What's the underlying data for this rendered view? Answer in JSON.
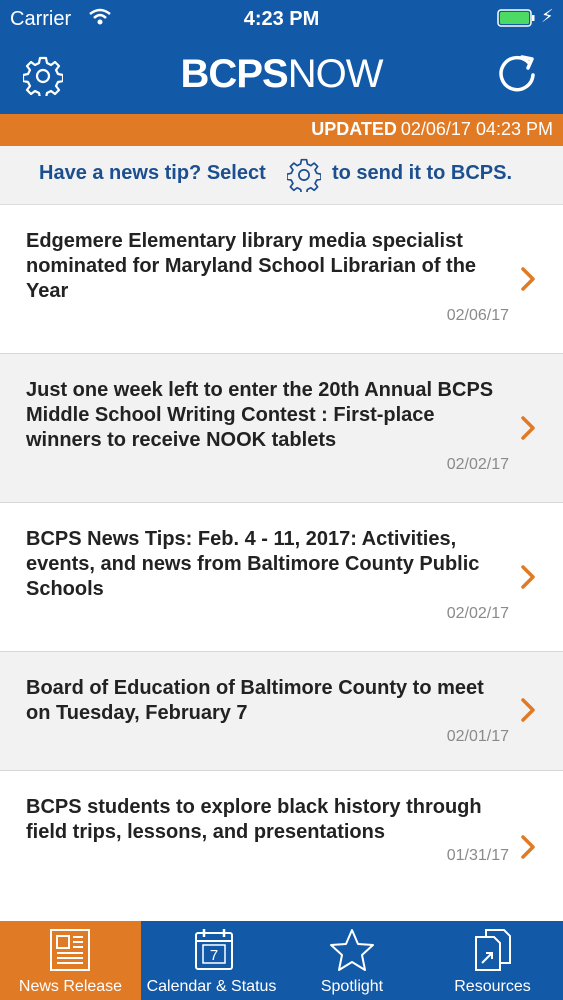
{
  "status_bar": {
    "carrier": "Carrier",
    "time": "4:23 PM"
  },
  "header": {
    "logo_bold": "BCPS",
    "logo_light": "NOW",
    "settings_icon": "gear-icon",
    "refresh_icon": "refresh-icon"
  },
  "updated": {
    "label": "UPDATED",
    "value": "02/06/17 04:23 PM"
  },
  "tip": {
    "before": "Have a news tip? Select",
    "after": "to send it to BCPS."
  },
  "news": [
    {
      "title": "Edgemere Elementary library media specialist nominated for Maryland School Librarian of the Year",
      "date": "02/06/17"
    },
    {
      "title": "Just one week left to enter the 20th Annual BCPS Middle School Writing Contest : First-place winners to receive NOOK tablets",
      "date": "02/02/17"
    },
    {
      "title": "BCPS News Tips: Feb. 4 - 11, 2017: Activities, events, and news from Baltimore County Public Schools",
      "date": "02/02/17"
    },
    {
      "title": "Board of Education of Baltimore County to meet on Tuesday, February 7",
      "date": "02/01/17"
    },
    {
      "title": "BCPS students to explore black history through field trips, lessons, and presentations",
      "date": "01/31/17"
    }
  ],
  "tabs": [
    {
      "label": "News Release",
      "icon": "newspaper-icon",
      "active": true
    },
    {
      "label": "Calendar & Status",
      "icon": "calendar-icon",
      "calendar_day": "7"
    },
    {
      "label": "Spotlight",
      "icon": "star-icon"
    },
    {
      "label": "Resources",
      "icon": "documents-icon"
    }
  ],
  "colors": {
    "primary": "#1259a8",
    "accent": "#e07a25"
  }
}
